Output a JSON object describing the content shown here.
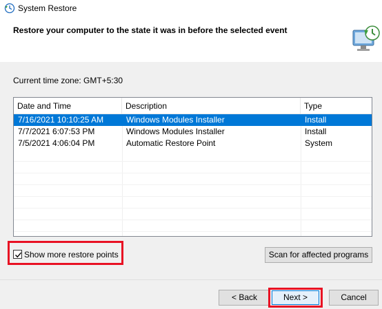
{
  "window": {
    "title": "System Restore"
  },
  "header": {
    "heading": "Restore your computer to the state it was in before the selected event"
  },
  "timezone_label": "Current time zone: GMT+5:30",
  "list": {
    "columns": [
      "Date and Time",
      "Description",
      "Type"
    ],
    "rows": [
      [
        "7/16/2021 10:10:25 AM",
        "Windows Modules Installer",
        "Install"
      ],
      [
        "7/7/2021 6:07:53 PM",
        "Windows Modules Installer",
        "Install"
      ],
      [
        "7/5/2021 4:06:04 PM",
        "Automatic Restore Point",
        "System"
      ]
    ],
    "selected_row": 0
  },
  "show_more": {
    "label": "Show more restore points",
    "checked": true
  },
  "buttons": {
    "scan": "Scan for affected programs",
    "back": "< Back",
    "next": "Next >",
    "cancel": "Cancel"
  },
  "colors": {
    "selection": "#0078d7",
    "highlight_border": "#e81123"
  },
  "icons": [
    "system-restore-icon",
    "restore-computer-graphic",
    "sort-chevron-icon",
    "checkmark-icon"
  ]
}
